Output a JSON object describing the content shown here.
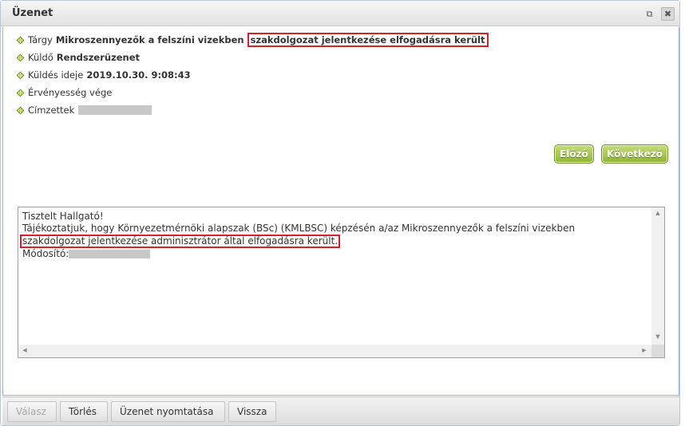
{
  "dialog": {
    "title": "Üzenet",
    "restore_icon": "⧉",
    "close_icon": "✖"
  },
  "meta": {
    "subject_label": "Tárgy",
    "subject_bold": "Mikroszennyezők a felszíni vizekben",
    "subject_highlight": "szakdolgozat jelentkezése elfogadásra került",
    "sender_label": "Küldő",
    "sender_value": "Rendszerüzenet",
    "sent_label": "Küldés ideje",
    "sent_value": "2019.10.30. 9:08:43",
    "expiry_label": "Érvényesség vége",
    "recipients_label": "Címzettek"
  },
  "nav": {
    "prev_label": "Előző",
    "next_label": "Következő"
  },
  "message": {
    "line1": "Tisztelt Hallgató!",
    "line2": "Tájékoztatjuk, hogy Környezetmérnöki alapszak (BSc) (KMLBSC) képzésén a/az Mikroszennyezők a felszíni vizekben",
    "line3_highlight": "szakdolgozat jelentkezése adminisztrátor által elfogadásra került.",
    "line4_label": "Módosító:"
  },
  "footer": {
    "reply_label": "Válasz",
    "delete_label": "Törlés",
    "print_label": "Üzenet nyomtatása",
    "back_label": "Vissza"
  }
}
